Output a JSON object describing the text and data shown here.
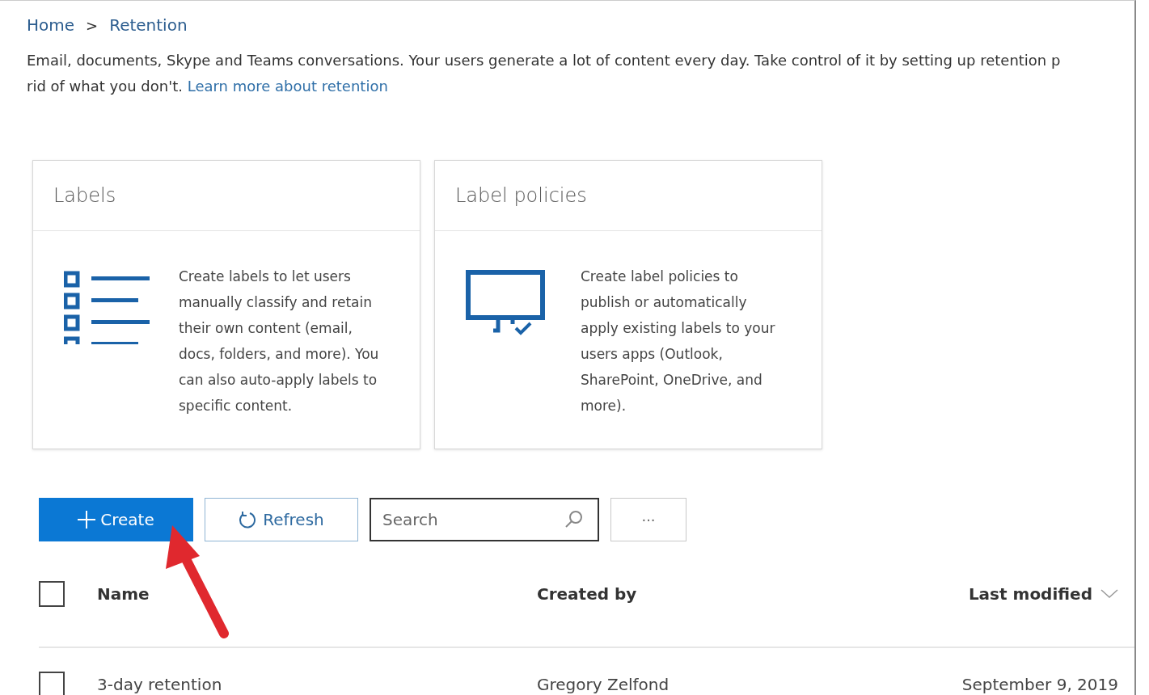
{
  "breadcrumb": [
    {
      "label": "Home"
    },
    {
      "label": "Retention"
    }
  ],
  "breadcrumb_separator": ">",
  "intro": {
    "line_1": "Email, documents, Skype and Teams conversations. Your users generate a lot of content every day. Take control of it by setting up retention p",
    "line_2": "rid of what you don't.",
    "link": "Learn more about retention"
  },
  "cards": [
    {
      "kind": "list",
      "title": "Labels",
      "description": "Create labels to let users manually classify and retain their own content (email, docs, folders, and more). You can also auto-apply labels to specific content."
    },
    {
      "kind": "monitor",
      "title": "Label policies",
      "description": "Create label policies to publish or automatically apply existing labels to your users apps (Outlook, SharePoint, OneDrive, and more)."
    }
  ],
  "toolbar": {
    "create": "Create",
    "refresh": "Refresh",
    "search": {
      "placeholder": "Search"
    },
    "more": "···"
  },
  "table": {
    "select_all": {
      "checked": false
    },
    "columns": [
      {
        "label": "Name"
      },
      {
        "label": "Created by"
      },
      {
        "label": "Last modified",
        "sorted": true
      }
    ],
    "rows": [
      {
        "checked": false,
        "cells": [
          "3-day retention",
          "Gregory Zelfond",
          "September 9, 2019"
        ]
      }
    ]
  }
}
